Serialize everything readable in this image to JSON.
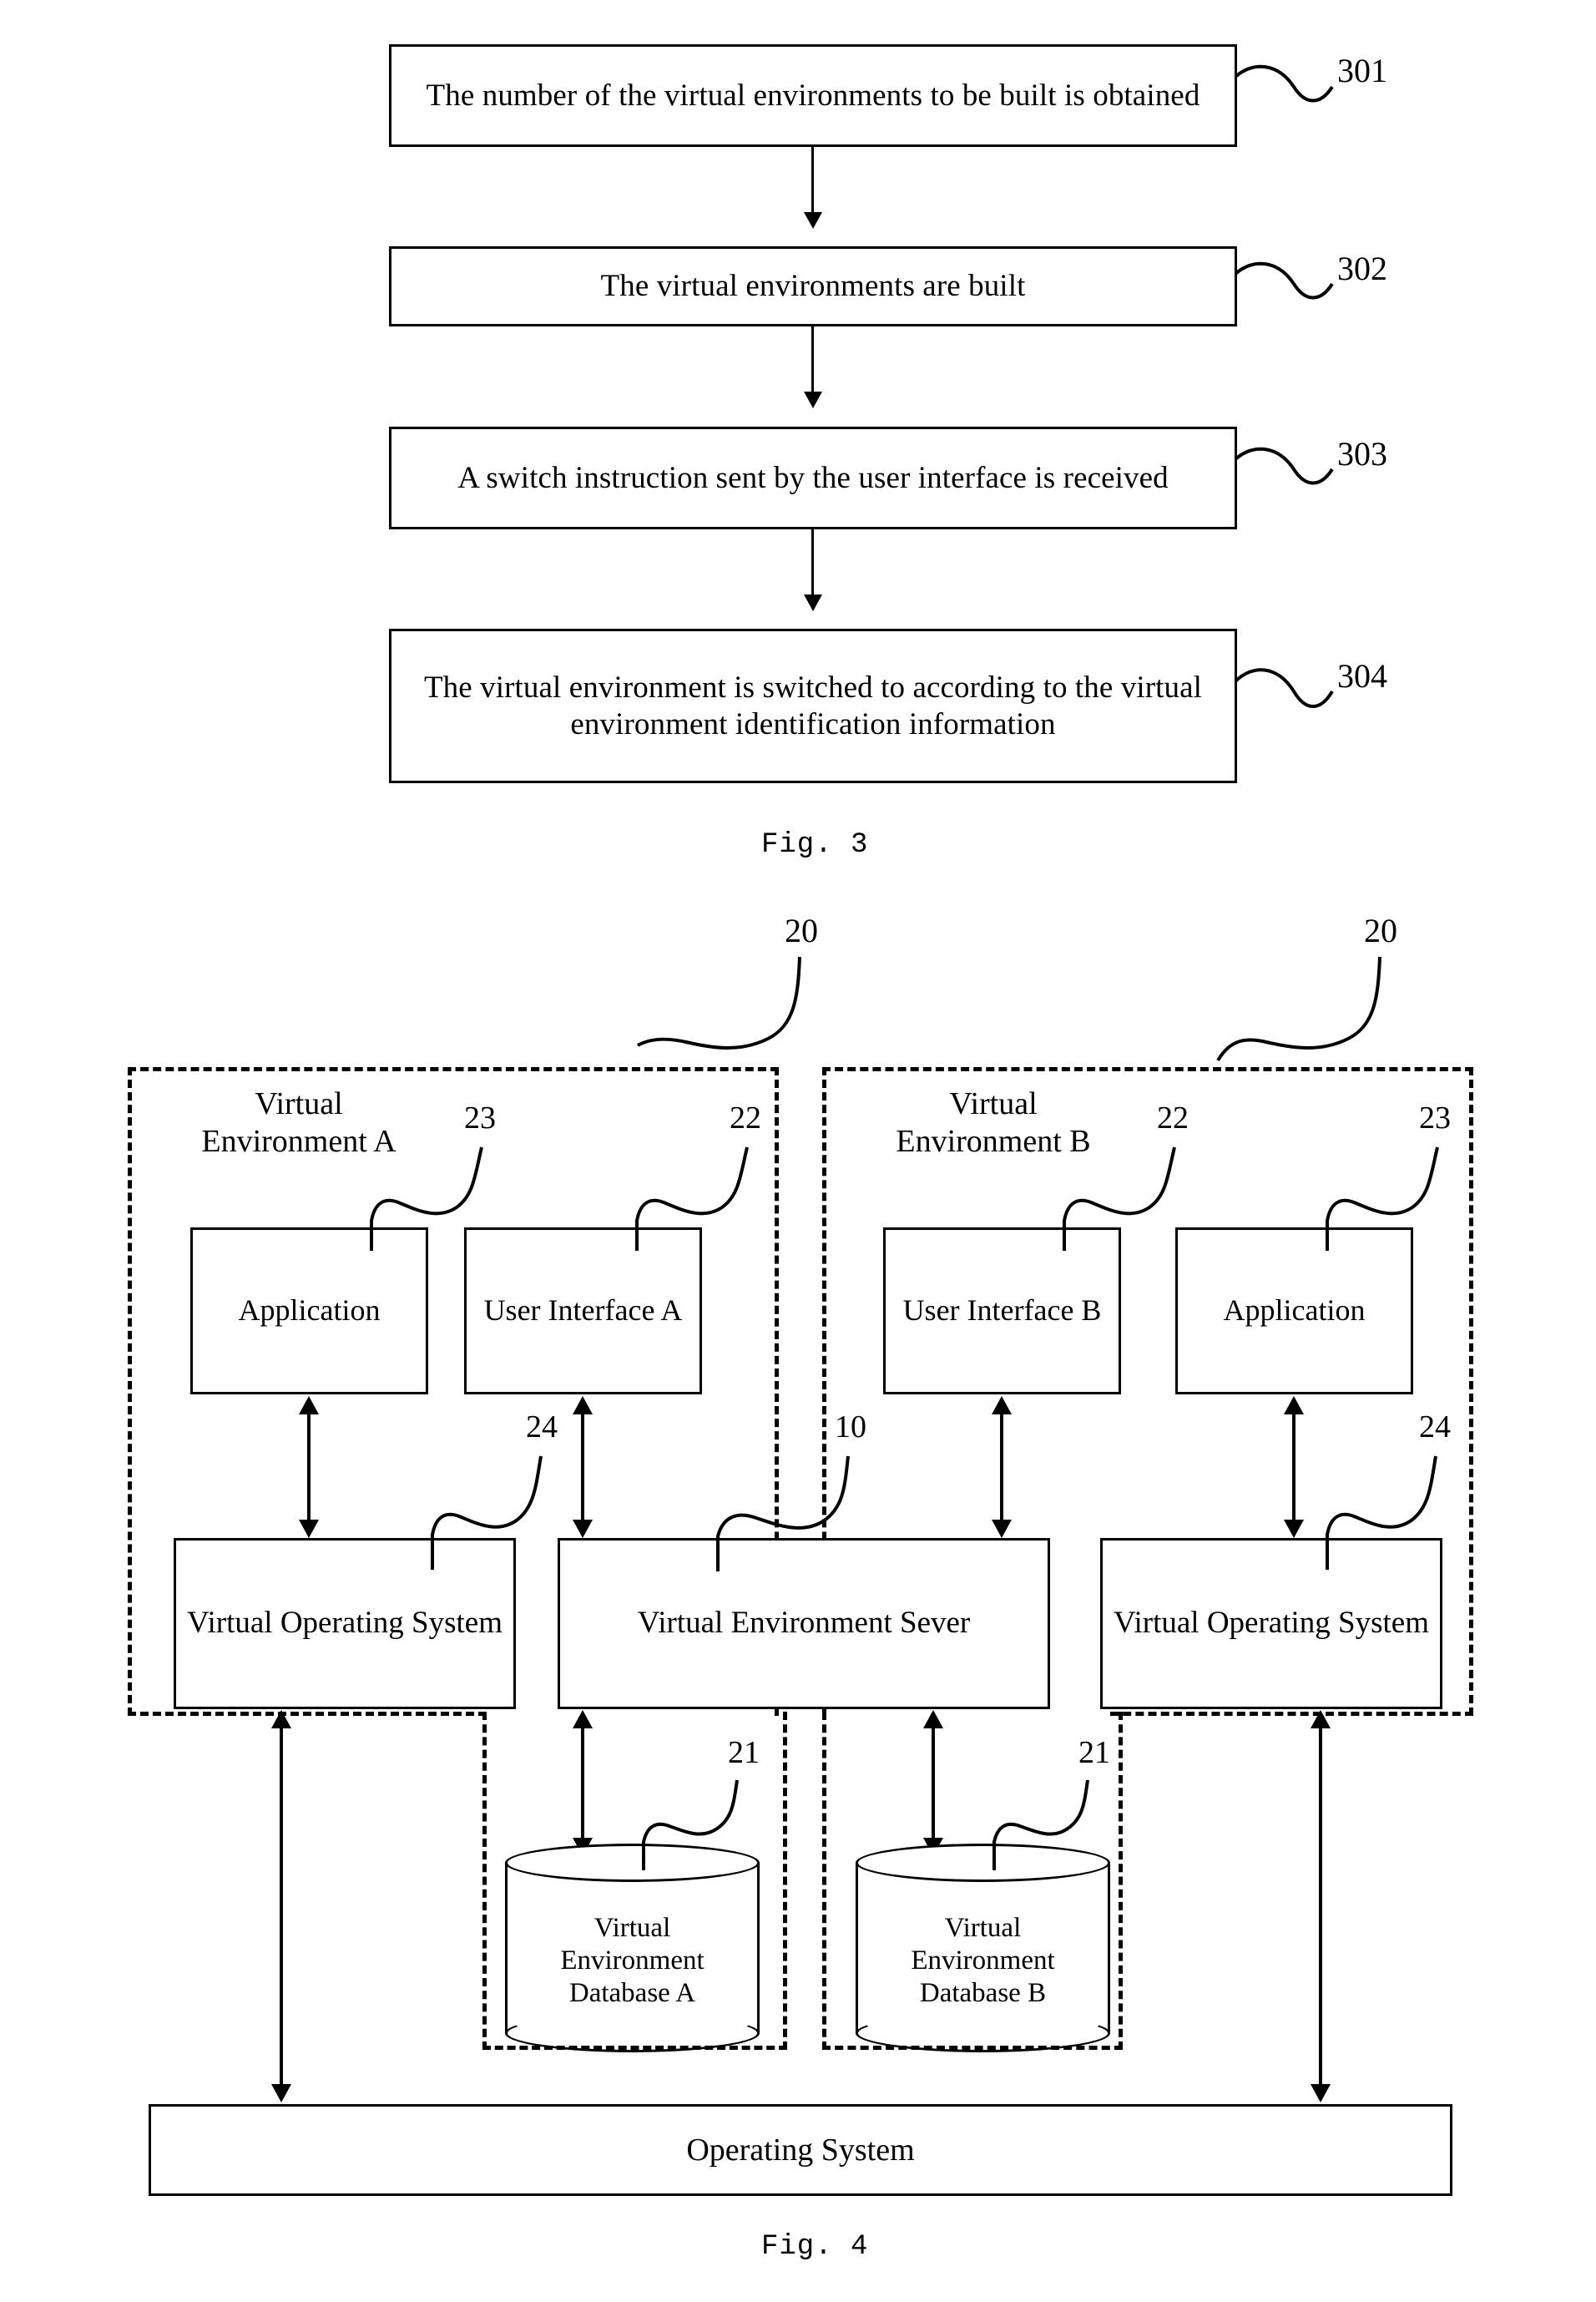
{
  "figure3": {
    "caption": "Fig. 3",
    "steps": [
      {
        "text": "The number of the virtual environments to be built is obtained",
        "ref": "301"
      },
      {
        "text": "The virtual environments are built",
        "ref": "302"
      },
      {
        "text": "A switch instruction sent by the user interface is received",
        "ref": "303"
      },
      {
        "text": "The virtual environment is switched to according to the virtual environment identification information",
        "ref": "304"
      }
    ]
  },
  "figure4": {
    "caption": "Fig. 4",
    "env_a": {
      "label": "Virtual\nEnvironment A",
      "ref": "20",
      "application": {
        "label": "Application",
        "ref": "23"
      },
      "user_interface": {
        "label": "User\nInterface A",
        "ref": "22"
      },
      "virtual_os": {
        "label": "Virtual Operating\nSystem",
        "ref": "24"
      },
      "database": {
        "label": "Virtual\nEnvironment\nDatabase A",
        "ref": "21"
      }
    },
    "env_b": {
      "label": "Virtual\nEnvironment B",
      "ref": "20",
      "application": {
        "label": "Application",
        "ref": "23"
      },
      "user_interface": {
        "label": "User\nInterface B",
        "ref": "22"
      },
      "virtual_os": {
        "label": "Virtual Operating\nSystem",
        "ref": "24"
      },
      "database": {
        "label": "Virtual\nEnvironment\nDatabase B",
        "ref": "21"
      }
    },
    "server": {
      "label": "Virtual Environment\nSever",
      "ref": "10"
    },
    "operating_system": {
      "label": "Operating System"
    }
  }
}
